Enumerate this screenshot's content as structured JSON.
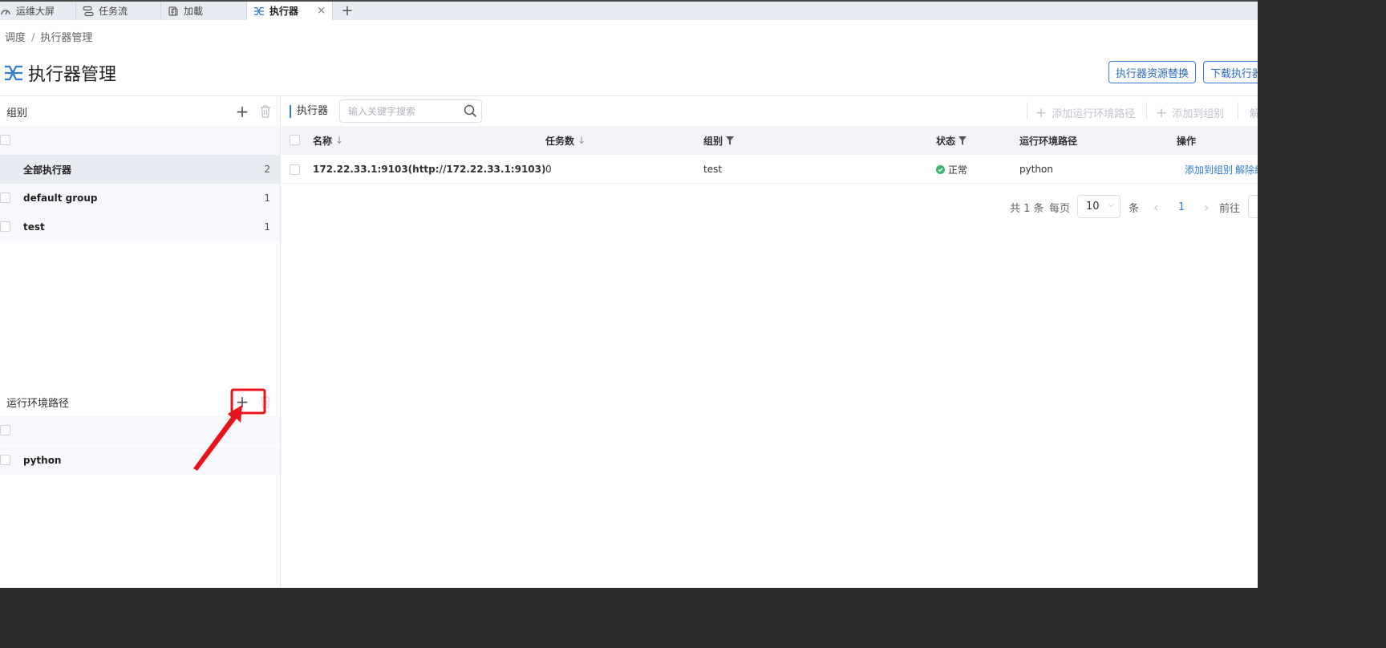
{
  "tabs": [
    {
      "label": "运维大屏",
      "icon": "gauge-icon"
    },
    {
      "label": "任务流",
      "icon": "workflow-icon"
    },
    {
      "label": "加載",
      "icon": "database-icon"
    },
    {
      "label": "执行器",
      "icon": "executor-icon",
      "active": true,
      "close": "×"
    }
  ],
  "tab_add": "+",
  "breadcrumb": [
    "调度",
    "执行器管理"
  ],
  "breadcrumb_sep": "/",
  "page_title": "执行器管理",
  "header_buttons": [
    "执行器资源替换",
    "下载执行器"
  ],
  "left": {
    "group_section": {
      "title": "组别",
      "add": "+",
      "items": [
        {
          "label": "全部执行器",
          "count": "2"
        },
        {
          "label": "default group",
          "count": "1"
        },
        {
          "label": "test",
          "count": "1"
        }
      ]
    },
    "env_section": {
      "title": "运行环境路径",
      "add": "+",
      "items": [
        {
          "label": "python"
        }
      ]
    }
  },
  "toolbar": {
    "label": "执行器",
    "search_placeholder": "输入关键字搜索",
    "add_env": "添加运行环境路径",
    "add_group": "添加到组别",
    "unbind": "解除组别",
    "plus": "+"
  },
  "table": {
    "columns": [
      "名称",
      "任务数",
      "组别",
      "状态",
      "运行环境路径",
      "操作"
    ],
    "sort_glyph": "↓",
    "rows": [
      {
        "name": "172.22.33.1:9103(http://172.22.33.1:9103)",
        "tasks": "0",
        "group": "test",
        "status": "正常",
        "env": "python",
        "action_add": "添加到组别",
        "action_unbind": "解除组别"
      }
    ]
  },
  "pagination": {
    "total": "共 1 条",
    "per_page": "每页",
    "page_size": "10",
    "unit": "条",
    "prev": "‹",
    "current": "1",
    "next": "›",
    "goto": "前往"
  },
  "colors": {
    "accent": "#2f7bd6",
    "status_ok": "#3bb56c",
    "annotation": "#e8141c"
  }
}
